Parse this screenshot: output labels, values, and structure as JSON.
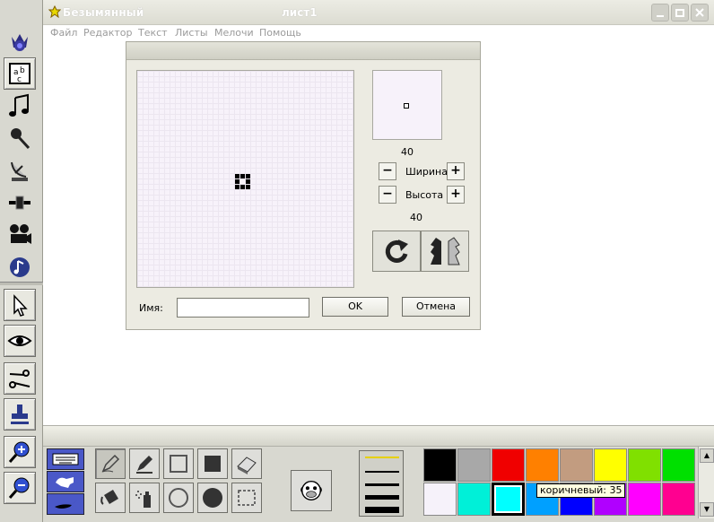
{
  "window": {
    "title": "Безымянный",
    "sheet_title": "лист1"
  },
  "menu": [
    "Файл",
    "Редактор",
    "Текст",
    "Листы",
    "Мелочи",
    "Помощь"
  ],
  "left_toolbar": [
    "crown-icon",
    "text-abc-icon",
    "music-note-icon",
    "microphone-icon",
    "satellite-dish-icon",
    "slider-icon",
    "movie-camera-icon",
    "music-disc-icon",
    "pointer-icon",
    "eye-icon",
    "scissors-icon",
    "stamp-icon",
    "zoom-in-icon",
    "zoom-out-icon"
  ],
  "shape_dialog": {
    "preview_size": "40",
    "width_label": "Ширина",
    "height_label": "Высота",
    "height_value": "40",
    "minus": "−",
    "plus": "+",
    "name_label": "Имя:",
    "name_value": "",
    "ok_label": "OK",
    "cancel_label": "Отмена"
  },
  "bottom_tools": [
    "pencil-icon",
    "pen-icon",
    "rectangle-icon",
    "filled-rectangle-icon",
    "eraser-icon",
    "paint-bucket-icon",
    "spray-can-icon",
    "circle-icon",
    "filled-circle-icon",
    "selection-rect-icon"
  ],
  "line_styles": [
    "thin-yellow",
    "thin",
    "medium",
    "thick",
    "thickest"
  ],
  "palette": {
    "colors": [
      "#000000",
      "#a8a8a8",
      "#f00000",
      "#ff8000",
      "#c29c80",
      "#ffff00",
      "#80e000",
      "#00e000",
      "#f6f2fa",
      "#00f0d8",
      "#00ffff",
      "#00a0ff",
      "#0000ff",
      "#b000ff",
      "#ff00ff",
      "#ff0090"
    ],
    "selected_index": 10,
    "tooltip": "коричневый: 35"
  }
}
